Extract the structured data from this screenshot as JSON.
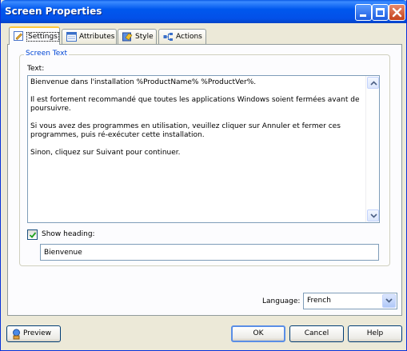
{
  "window": {
    "title": "Screen Properties"
  },
  "tabs": [
    {
      "label": "Settings",
      "icon": "edit-icon",
      "active": true
    },
    {
      "label": "Attributes",
      "icon": "attributes-icon",
      "active": false
    },
    {
      "label": "Style",
      "icon": "style-icon",
      "active": false
    },
    {
      "label": "Actions",
      "icon": "actions-icon",
      "active": false
    }
  ],
  "screen_text": {
    "group_label": "Screen Text",
    "text_label": "Text:",
    "paragraphs": [
      "Bienvenue dans l'installation %ProductName% %ProductVer%.",
      "Il est fortement recommandé que toutes les applications Windows soient fermées avant de poursuivre.",
      "Si vous avez des programmes en utilisation, veuillez cliquer sur Annuler et fermer ces programmes, puis ré-exécuter cette installation.",
      "Sinon, cliquez sur Suivant pour continuer."
    ],
    "show_heading_label": "Show heading:",
    "show_heading_checked": true,
    "heading_value": "Bienvenue"
  },
  "language": {
    "label": "Language:",
    "selected": "French"
  },
  "buttons": {
    "preview": "Preview",
    "ok": "OK",
    "cancel": "Cancel",
    "help": "Help"
  },
  "colors": {
    "titlebar": "#0058ee",
    "group_label": "#0046d5",
    "active_tab_accent": "#ffc83c"
  }
}
